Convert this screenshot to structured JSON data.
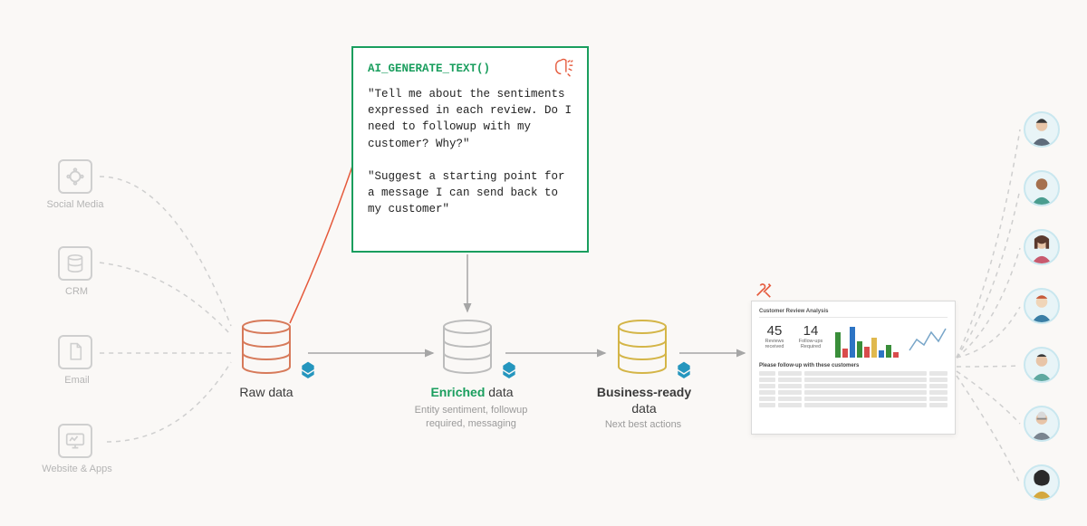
{
  "sources": {
    "social": "Social Media",
    "crm": "CRM",
    "email": "Email",
    "web": "Website & Apps"
  },
  "stages": {
    "raw": "Raw data",
    "enriched_prefix": "Enriched",
    "enriched_suffix": " data",
    "enriched_sub": "Entity sentiment, followup required, messaging",
    "business_prefix": "Business-ready",
    "business_suffix": "data",
    "business_sub": "Next best actions"
  },
  "code": {
    "fn": "AI_GENERATE_TEXT()",
    "p1": "\"Tell me about the sentiments expressed in each review. Do I need to followup with my customer? Why?\"",
    "p2": "\"Suggest a starting point for a message I can send back to my customer\""
  },
  "dashboard": {
    "header": "Customer Review Analysis",
    "metric1_num": "45",
    "metric1_lbl": "Reviews received",
    "metric2_num": "14",
    "metric2_lbl": "Follow-ups Required",
    "section": "Please follow-up with these customers"
  },
  "colors": {
    "accent_green": "#1a9e5e",
    "accent_rose": "#e5593b",
    "db_raw": "#d77a5a",
    "db_enriched": "#bcbcbc",
    "db_business": "#d4b547"
  }
}
